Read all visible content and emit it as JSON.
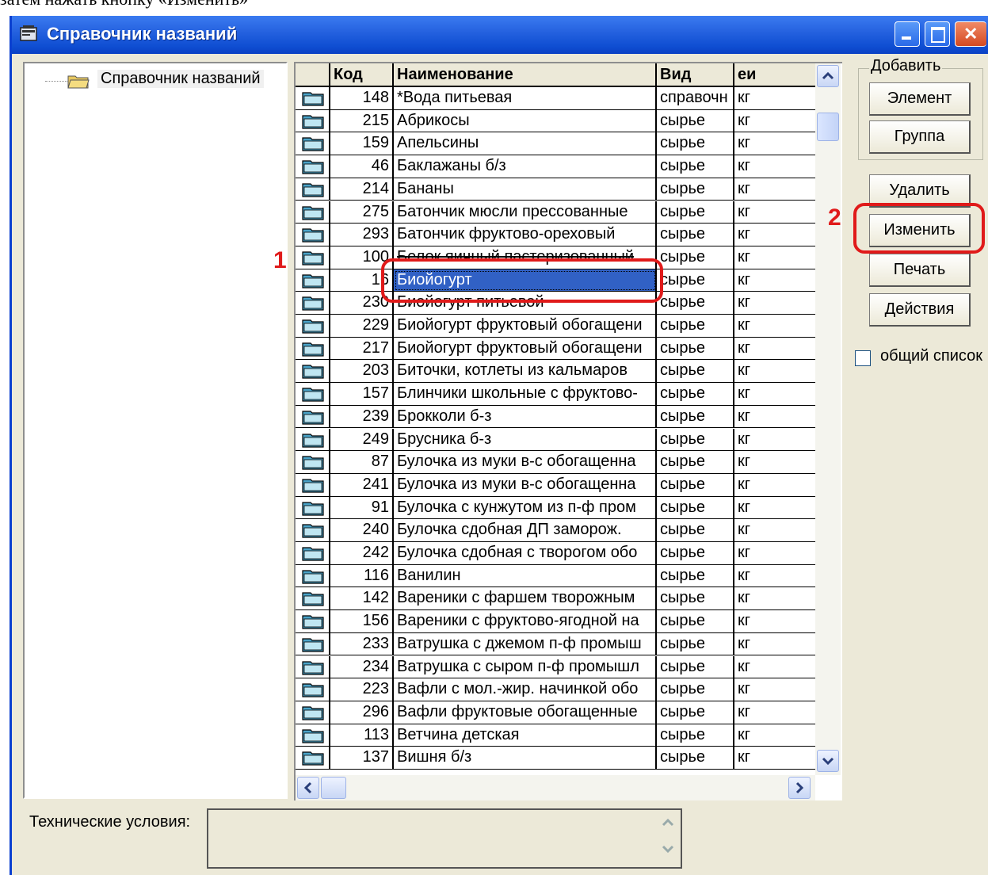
{
  "doc_caption": "затем нажать кнопку «Изменить»",
  "window": {
    "title": "Справочник названий"
  },
  "tree": {
    "root_label": "Справочник названий"
  },
  "grid": {
    "columns": [
      "Код",
      "Наименование",
      "Вид",
      "еи"
    ],
    "rows": [
      {
        "code": "148",
        "name": "*Вода питьевая",
        "kind": "справочн",
        "unit": "кг"
      },
      {
        "code": "215",
        "name": "Абрикосы",
        "kind": "сырье",
        "unit": "кг"
      },
      {
        "code": "159",
        "name": "Апельсины",
        "kind": "сырье",
        "unit": "кг"
      },
      {
        "code": "46",
        "name": "Баклажаны б/з",
        "kind": "сырье",
        "unit": "кг"
      },
      {
        "code": "214",
        "name": "Бананы",
        "kind": "сырье",
        "unit": "кг"
      },
      {
        "code": "275",
        "name": "Батончик мюсли прессованные",
        "kind": "сырье",
        "unit": "кг"
      },
      {
        "code": "293",
        "name": "Батончик фруктово-ореховый",
        "kind": "сырье",
        "unit": "кг"
      },
      {
        "code": "100",
        "name": "Белок яичный пастеризованный",
        "kind": "сырье",
        "unit": "кг"
      },
      {
        "code": "16",
        "name": "Биойогурт",
        "kind": "сырье",
        "unit": "кг"
      },
      {
        "code": "230",
        "name": "Биойогурт питьевой",
        "kind": "сырье",
        "unit": "кг"
      },
      {
        "code": "229",
        "name": "Биойогурт фруктовый обогащени",
        "kind": "сырье",
        "unit": "кг"
      },
      {
        "code": "217",
        "name": "Биойогурт фруктовый обогащени",
        "kind": "сырье",
        "unit": "кг"
      },
      {
        "code": "203",
        "name": "Биточки, котлеты из кальмаров",
        "kind": "сырье",
        "unit": "кг"
      },
      {
        "code": "157",
        "name": "Блинчики школьные с фруктово-",
        "kind": "сырье",
        "unit": "кг"
      },
      {
        "code": "239",
        "name": "Брокколи б-з",
        "kind": "сырье",
        "unit": "кг"
      },
      {
        "code": "249",
        "name": "Брусника б-з",
        "kind": "сырье",
        "unit": "кг"
      },
      {
        "code": "87",
        "name": "Булочка из муки в-с обогащенна",
        "kind": "сырье",
        "unit": "кг"
      },
      {
        "code": "241",
        "name": "Булочка из муки в-с обогащенна",
        "kind": "сырье",
        "unit": "кг"
      },
      {
        "code": "91",
        "name": "Булочка с кунжутом из п-ф пром",
        "kind": "сырье",
        "unit": "кг"
      },
      {
        "code": "240",
        "name": "Булочка сдобная ДП заморож.",
        "kind": "сырье",
        "unit": "кг"
      },
      {
        "code": "242",
        "name": "Булочка сдобная с творогом обо",
        "kind": "сырье",
        "unit": "кг"
      },
      {
        "code": "116",
        "name": "Ванилин",
        "kind": "сырье",
        "unit": "кг"
      },
      {
        "code": "142",
        "name": "Вареники с фаршем творожным",
        "kind": "сырье",
        "unit": "кг"
      },
      {
        "code": "156",
        "name": "Вареники с фруктово-ягодной на",
        "kind": "сырье",
        "unit": "кг"
      },
      {
        "code": "233",
        "name": "Ватрушка с джемом п-ф промыш",
        "kind": "сырье",
        "unit": "кг"
      },
      {
        "code": "234",
        "name": "Ватрушка с сыром п-ф промышл",
        "kind": "сырье",
        "unit": "кг"
      },
      {
        "code": "223",
        "name": "Вафли с мол.-жир. начинкой обо",
        "kind": "сырье",
        "unit": "кг"
      },
      {
        "code": "296",
        "name": "Вафли фруктовые обогащенные",
        "kind": "сырье",
        "unit": "кг"
      },
      {
        "code": "113",
        "name": "Ветчина детская",
        "kind": "сырье",
        "unit": "кг"
      },
      {
        "code": "137",
        "name": "Вишня б/з",
        "kind": "сырье",
        "unit": "кг"
      }
    ]
  },
  "buttons": {
    "add_group_label": "Добавить",
    "element": "Элемент",
    "group": "Группа",
    "delete": "Удалить",
    "edit": "Изменить",
    "print": "Печать",
    "actions": "Действия"
  },
  "common_list_label": "общий список",
  "tech_conditions_label": "Технические условия:",
  "annotations": {
    "one": "1",
    "two": "2"
  },
  "colors": {
    "title_bar": "#0a40c4",
    "selection": "#3161c5",
    "annotation": "#e01a1a",
    "folder": "#4aa3c8"
  }
}
